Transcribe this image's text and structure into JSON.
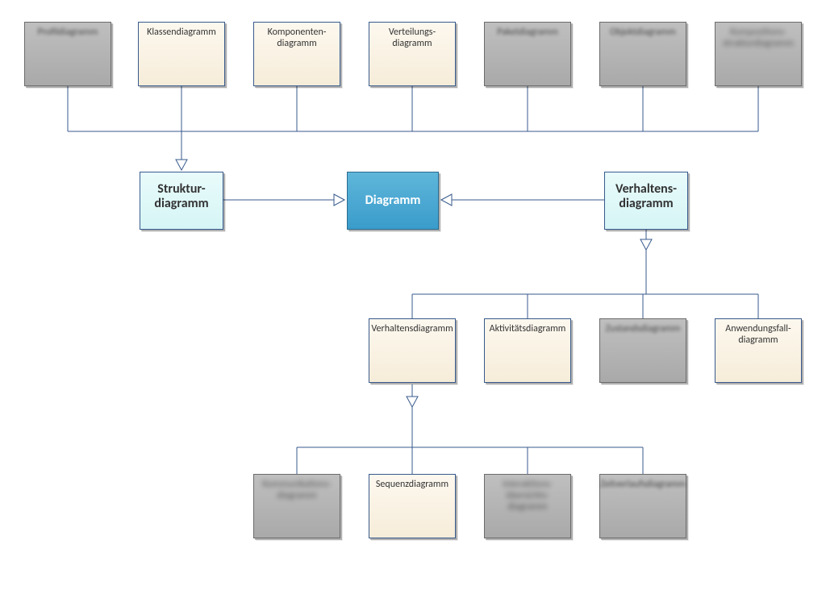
{
  "chart_data": {
    "type": "hierarchy",
    "root": "Diagramm",
    "children": [
      {
        "label": "Struktur-diagramm",
        "children": [
          {
            "label": "Profildiagramm",
            "dim": true
          },
          {
            "label": "Klassendiagramm"
          },
          {
            "label": "Komponenten-diagramm"
          },
          {
            "label": "Verteilungs-diagramm"
          },
          {
            "label": "Paketdiagramm",
            "dim": true
          },
          {
            "label": "Objektdiagramm",
            "dim": true
          },
          {
            "label": "Kompositionsstrukturdiagramm",
            "dim": true
          }
        ]
      },
      {
        "label": "Verhaltens-diagramm",
        "children": [
          {
            "label": "Verhaltensdiagramm",
            "children": [
              {
                "label": "Kommunikationsdiagramm",
                "dim": true
              },
              {
                "label": "Sequenzdiagramm"
              },
              {
                "label": "Interaktionsübersichtsdiagramm",
                "dim": true
              },
              {
                "label": "Zeitverlaufsdiagramm",
                "dim": true
              }
            ]
          },
          {
            "label": "Aktivitätsdiagramm"
          },
          {
            "label": "Zustandsdiagramm",
            "dim": true
          },
          {
            "label": "Anwendungsfall-diagramm"
          }
        ]
      }
    ]
  },
  "nodes": {
    "top1": "Profildiagramm",
    "top2": "Klassendiagramm",
    "top3a": "Komponenten-",
    "top3b": "diagramm",
    "top4a": "Verteilungs-",
    "top4b": "diagramm",
    "top5": "Paketdiagramm",
    "top6": "Objektdiagramm",
    "top7a": "Kompositions-",
    "top7b": "strukturdiagramm",
    "struktur_a": "Struktur-",
    "struktur_b": "diagramm",
    "diagramm": "Diagramm",
    "verhalten_a": "Verhaltens-",
    "verhalten_b": "diagramm",
    "mid1": "Verhaltensdiagramm",
    "mid2": "Aktivitätsdiagramm",
    "mid3": "Zustandsdiagramm",
    "mid4a": "Anwendungsfall-",
    "mid4b": "diagramm",
    "bot1a": "Kommunikations-",
    "bot1b": "diagramm",
    "bot2": "Sequenzdiagramm",
    "bot3a": "Interaktions-",
    "bot3b": "übersichts-",
    "bot3c": "diagramm",
    "bot4": "Zeitverlaufsdiagramm"
  }
}
